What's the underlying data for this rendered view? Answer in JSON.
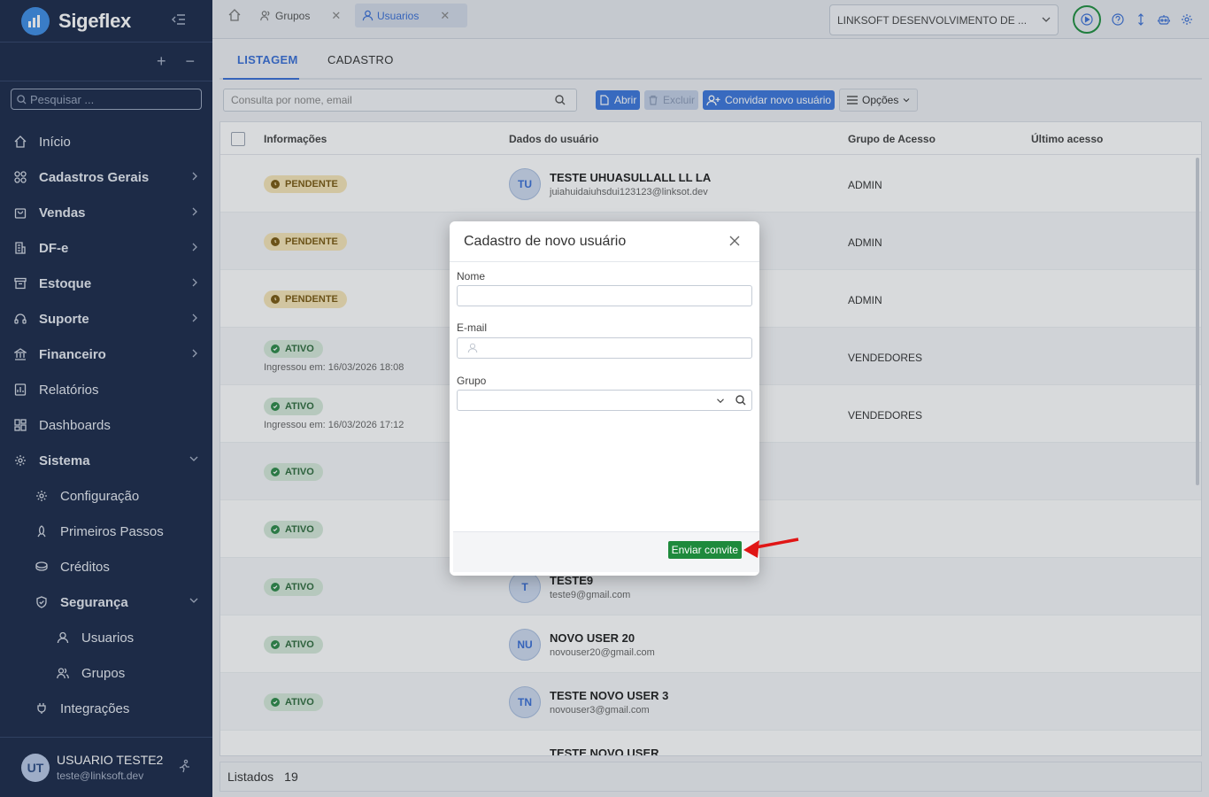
{
  "brand": {
    "name": "Sigeflex"
  },
  "sidebar": {
    "search_placeholder": "Pesquisar ...",
    "items": [
      {
        "label": "Início"
      },
      {
        "label": "Cadastros Gerais"
      },
      {
        "label": "Vendas"
      },
      {
        "label": "DF-e"
      },
      {
        "label": "Estoque"
      },
      {
        "label": "Suporte"
      },
      {
        "label": "Financeiro"
      },
      {
        "label": "Relatórios"
      },
      {
        "label": "Dashboards"
      },
      {
        "label": "Sistema"
      },
      {
        "label": "Configuração"
      },
      {
        "label": "Primeiros Passos"
      },
      {
        "label": "Créditos"
      },
      {
        "label": "Segurança"
      },
      {
        "label": "Usuarios"
      },
      {
        "label": "Grupos"
      },
      {
        "label": "Integrações"
      }
    ],
    "user": {
      "initials": "UT",
      "name": "USUARIO TESTE2",
      "email": "teste@linksoft.dev"
    }
  },
  "topbar": {
    "tabs": [
      {
        "label": "Grupos"
      },
      {
        "label": "Usuarios"
      }
    ],
    "company": "LINKSOFT DESENVOLVIMENTO DE ..."
  },
  "subtabs": {
    "list": "LISTAGEM",
    "form": "CADASTRO"
  },
  "toolbar": {
    "search_placeholder": "Consulta por nome, email",
    "open": "Abrir",
    "delete": "Excluir",
    "invite": "Convidar novo usuário",
    "options": "Opções"
  },
  "grid": {
    "headers": {
      "info": "Informações",
      "user": "Dados do usuário",
      "group": "Grupo de Acesso",
      "last": "Último acesso"
    },
    "rows": [
      {
        "status": "PENDENTE",
        "joined": "",
        "initials": "TU",
        "name": "TESTE UHUASULLALL LL LA",
        "email": "juiahuidaiuhsdui123123@linksot.dev",
        "group": "ADMIN"
      },
      {
        "status": "PENDENTE",
        "joined": "",
        "initials": "",
        "name": "",
        "email": "",
        "group": "ADMIN"
      },
      {
        "status": "PENDENTE",
        "joined": "",
        "initials": "",
        "name": "",
        "email": "",
        "group": "ADMIN"
      },
      {
        "status": "ATIVO",
        "joined": "Ingressou em: 16/03/2026 18:08",
        "initials": "",
        "name": "",
        "email": "",
        "group": "VENDEDORES"
      },
      {
        "status": "ATIVO",
        "joined": "Ingressou em: 16/03/2026 17:12",
        "initials": "",
        "name": "",
        "email": "",
        "group": "VENDEDORES"
      },
      {
        "status": "ATIVO",
        "joined": "",
        "initials": "",
        "name": "",
        "email": "",
        "group": ""
      },
      {
        "status": "ATIVO",
        "joined": "",
        "initials": "",
        "name": "",
        "email": "",
        "group": ""
      },
      {
        "status": "ATIVO",
        "joined": "",
        "initials": "T",
        "name": "TESTE9",
        "email": "teste9@gmail.com",
        "group": ""
      },
      {
        "status": "ATIVO",
        "joined": "",
        "initials": "NU",
        "name": "NOVO USER 20",
        "email": "novouser20@gmail.com",
        "group": ""
      },
      {
        "status": "ATIVO",
        "joined": "",
        "initials": "TN",
        "name": "TESTE NOVO USER 3",
        "email": "novouser3@gmail.com",
        "group": ""
      },
      {
        "status": "",
        "joined": "",
        "initials": "",
        "name": "TESTE NOVO USER",
        "email": "",
        "group": ""
      }
    ]
  },
  "footer": {
    "label": "Listados",
    "count": "19"
  },
  "modal": {
    "title": "Cadastro de novo usuário",
    "name_label": "Nome",
    "email_label": "E-mail",
    "group_label": "Grupo",
    "send": "Enviar convite"
  },
  "colors": {
    "sidebar": "#1b2a4a",
    "accent": "#3a6fd6",
    "send": "#1e8a3c",
    "annotation": "#e01616"
  }
}
